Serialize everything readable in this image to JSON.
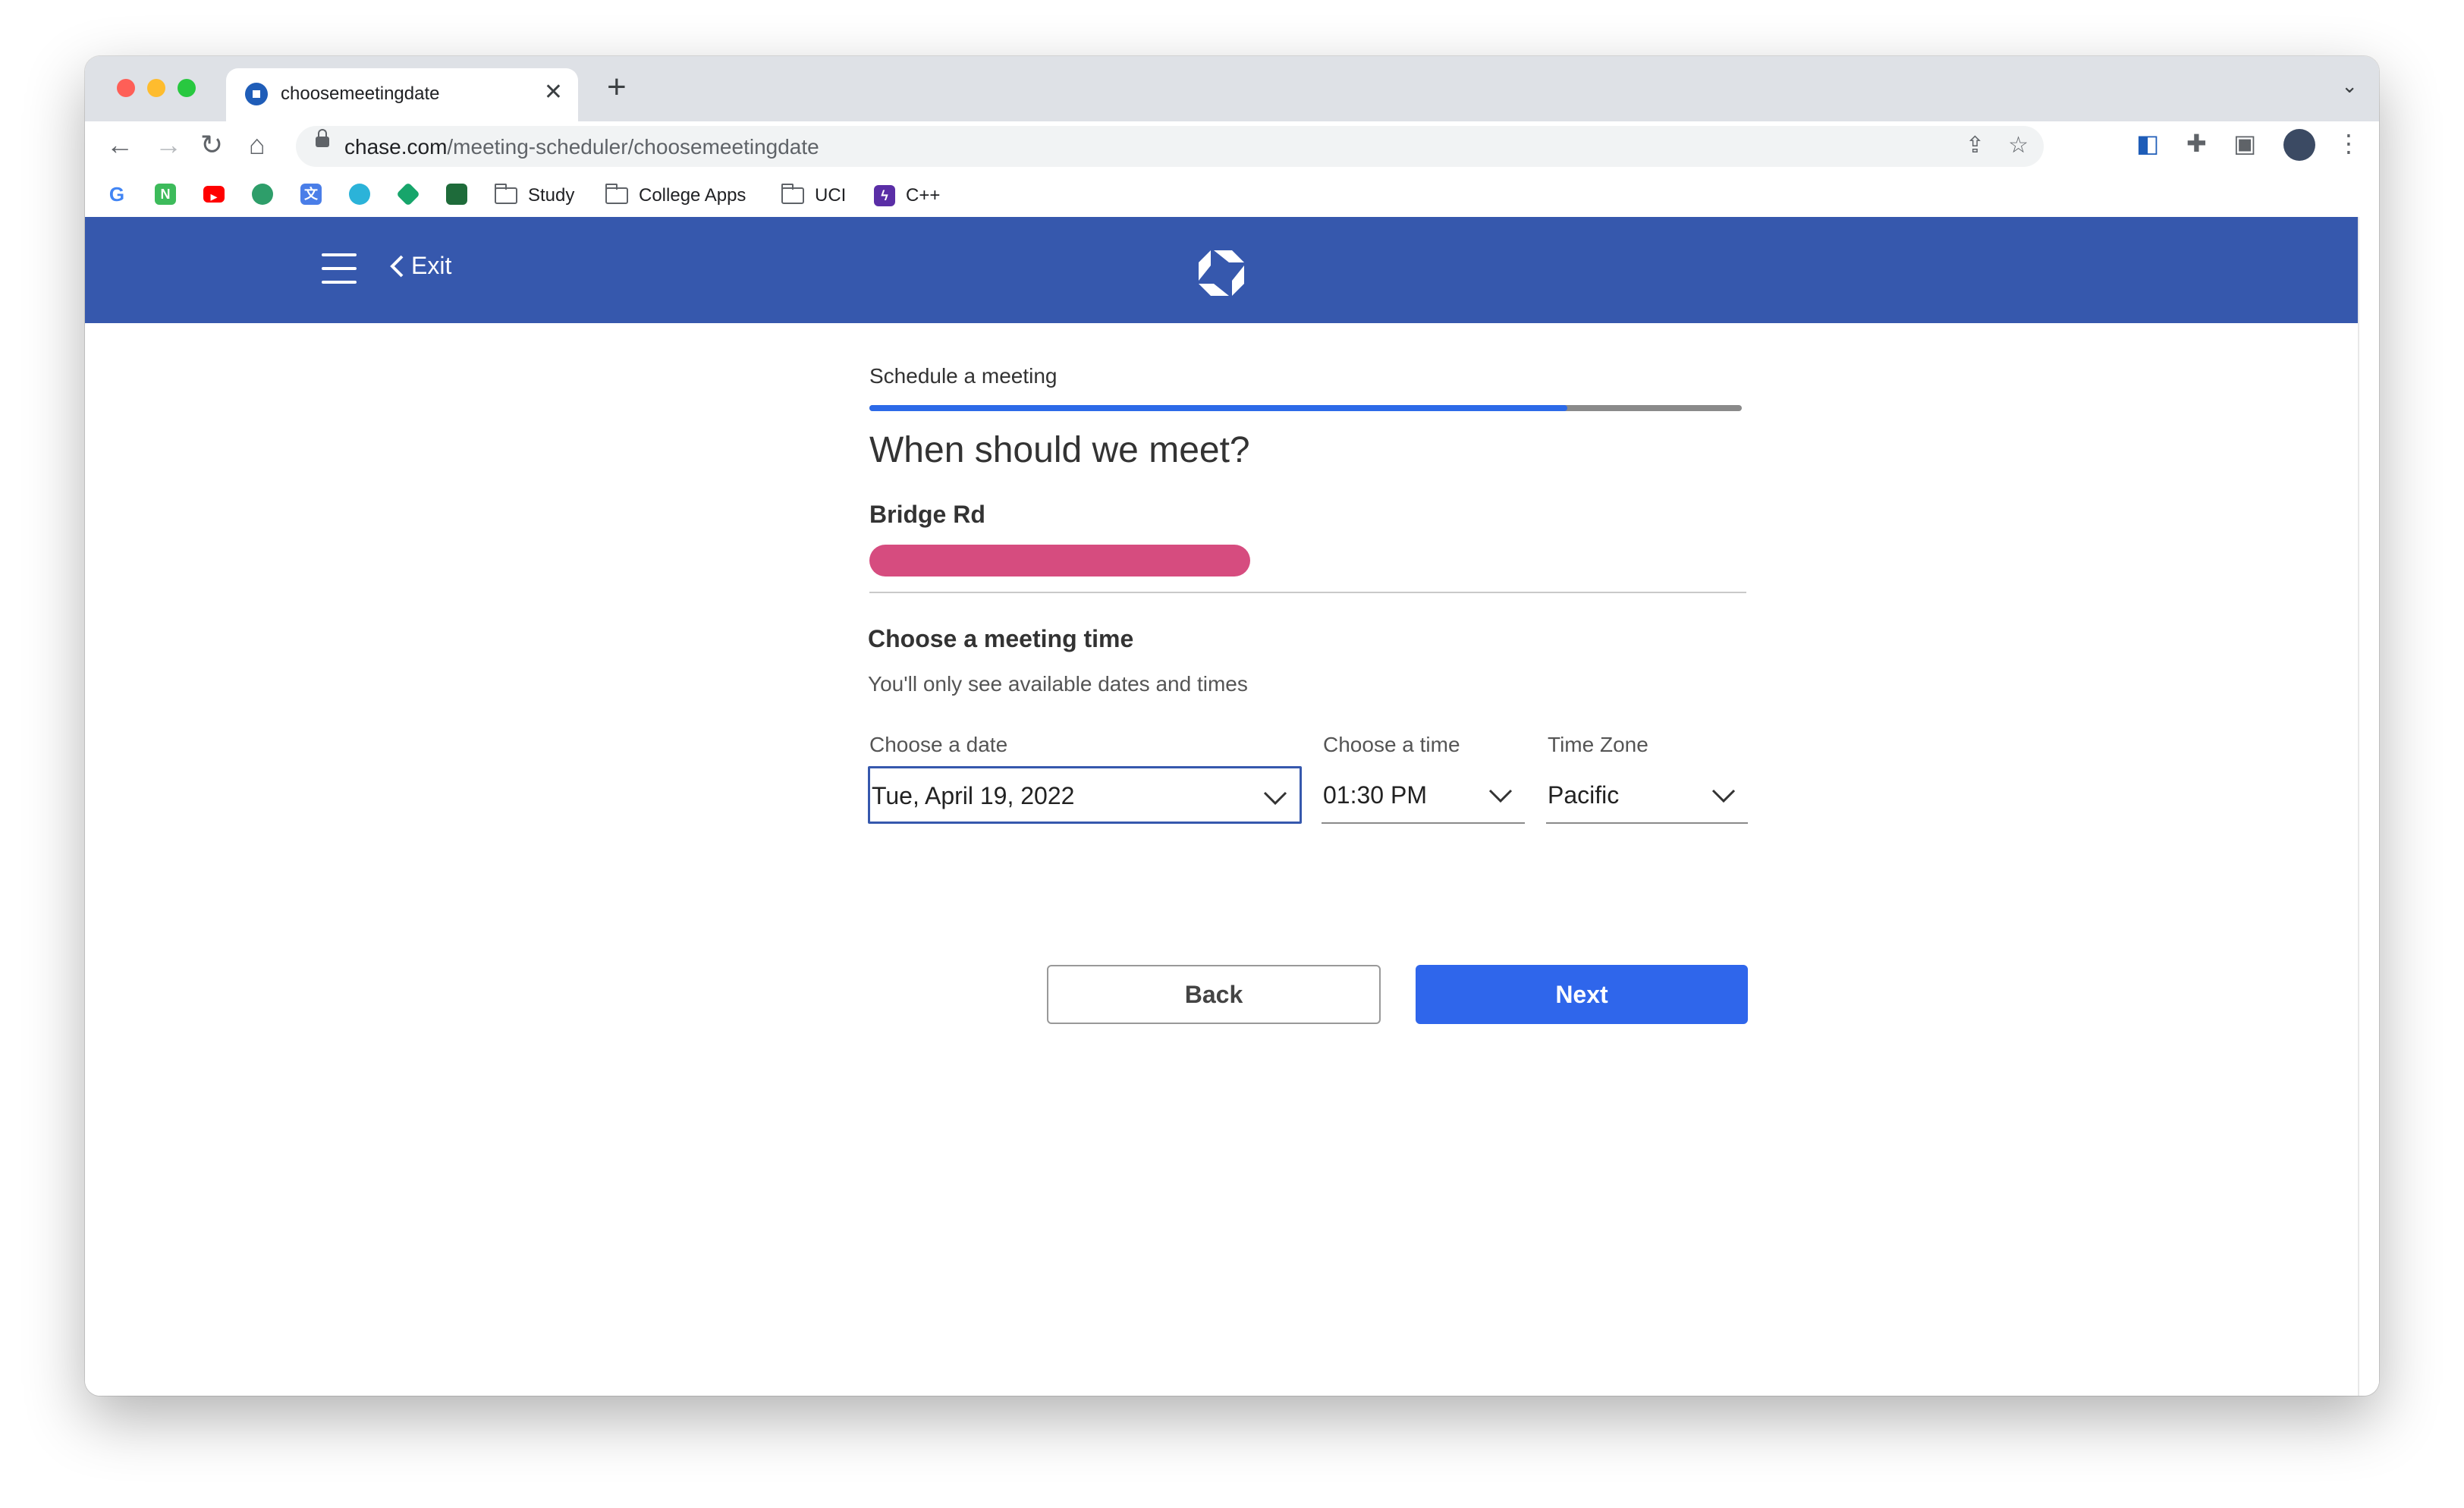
{
  "browser": {
    "tab_title": "choosemeetingdate",
    "url_domain": "chase.com",
    "url_path": "/meeting-scheduler/choosemeetingdate",
    "bookmarks": [
      {
        "icon": "google-icon"
      },
      {
        "icon": "notion-n-icon"
      },
      {
        "icon": "youtube-icon"
      },
      {
        "icon": "app-icon"
      },
      {
        "icon": "translate-icon"
      },
      {
        "icon": "app-icon"
      },
      {
        "icon": "app-icon"
      },
      {
        "icon": "app-icon"
      }
    ],
    "bookmark_folders": [
      "Study",
      "College Apps",
      "UCI"
    ],
    "bookmark_cpp": "C++"
  },
  "header": {
    "exit_label": "Exit",
    "brand_color": "#3658ad"
  },
  "progress": {
    "label": "Schedule a meeting",
    "fraction": 0.8
  },
  "main": {
    "heading": "When should we meet?",
    "branch_name": "Bridge Rd",
    "section_title": "Choose a meeting time",
    "section_subtitle": "You'll only see available dates and times"
  },
  "fields": {
    "date_label": "Choose a date",
    "date_value": "Tue, April 19, 2022",
    "time_label": "Choose a time",
    "time_value": "01:30 PM",
    "tz_label": "Time Zone",
    "tz_value": "Pacific"
  },
  "buttons": {
    "back": "Back",
    "next": "Next",
    "next_color": "#2f66eb"
  }
}
